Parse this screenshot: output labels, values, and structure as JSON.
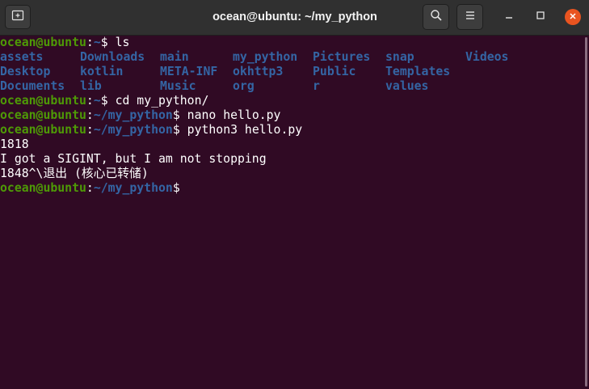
{
  "window": {
    "title": "ocean@ubuntu: ~/my_python"
  },
  "colors": {
    "background": "#300a24",
    "user": "#4e9a06",
    "path": "#3465a4",
    "close": "#e95420"
  },
  "terminal": {
    "line1": {
      "user": "ocean@ubuntu",
      "sep": ":",
      "path": "~",
      "prompt": "$ ",
      "cmd": "ls"
    },
    "ls_rows": [
      [
        "assets",
        "Downloads",
        "main",
        "my_python",
        "Pictures",
        "snap",
        "Videos"
      ],
      [
        "Desktop",
        "kotlin",
        "META-INF",
        "okhttp3",
        "Public",
        "Templates",
        ""
      ],
      [
        "Documents",
        "lib",
        "Music",
        "org",
        "r",
        "values",
        ""
      ]
    ],
    "line5": {
      "user": "ocean@ubuntu",
      "sep": ":",
      "path": "~",
      "prompt": "$ ",
      "cmd": "cd my_python/"
    },
    "line6": {
      "user": "ocean@ubuntu",
      "sep": ":",
      "path": "~/my_python",
      "prompt": "$ ",
      "cmd": "nano hello.py"
    },
    "line7": {
      "user": "ocean@ubuntu",
      "sep": ":",
      "path": "~/my_python",
      "prompt": "$ ",
      "cmd": "python3 hello.py"
    },
    "output": [
      "1818",
      "I got a SIGINT, but I am not stopping",
      "1848^\\退出 (核心已转储)"
    ],
    "line11": {
      "user": "ocean@ubuntu",
      "sep": ":",
      "path": "~/my_python",
      "prompt": "$"
    }
  }
}
